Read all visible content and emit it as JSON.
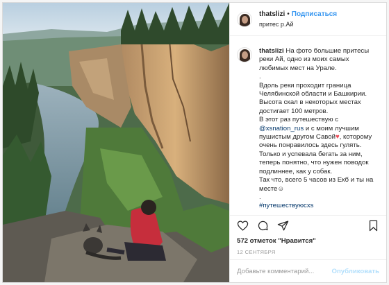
{
  "post": {
    "username": "thatslizi",
    "follow_label": "Подписаться",
    "separator": "•",
    "location": "притес р.Ай",
    "photo_alt": "",
    "caption_lines": [
      "На фото большие притесы",
      "реки Ай, одно из моих самых",
      "любимых мест на Урале.",
      ".",
      "Вдоль реки проходит граница",
      "Челябинской области и Башкирии.",
      "Высота скал в некоторых местах",
      "достигает 100 метров.",
      "В этот раз путешествую с",
      "и с моим лучшим",
      "пушистым другом Савой",
      ", которому",
      "очень понравилось здесь гулять.",
      "Только и успевала бегать за ним,",
      "теперь понятно, что нужен поводок",
      "подлиннее, как у собак.",
      "Так что, всего 5 часов из Екб и ты на",
      "месте",
      ".",
      "#путешествуюсxs"
    ],
    "mention": "@xsnation_rus",
    "heart_emoji": "♥",
    "smile_emoji": "☺",
    "likes": "572 отметок \"Нравится\"",
    "date": "12 сентября",
    "comment_placeholder": "Добавьте комментарий...",
    "publish_label": "Опубликовать",
    "icons": {
      "like": "heart-icon",
      "comment": "comment-icon",
      "share": "share-icon",
      "save": "bookmark-icon"
    },
    "colors": {
      "link": "#3897f0",
      "publish_disabled": "#b2dffc",
      "border": "#dbdbdb",
      "heart_emoji": "#ed4956"
    }
  }
}
